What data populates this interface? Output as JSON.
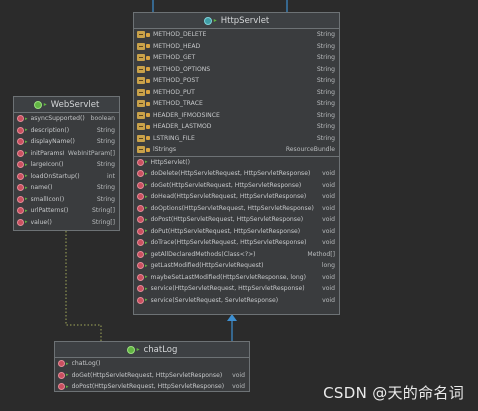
{
  "diagram": {
    "http_servlet": {
      "title": "HttpServlet",
      "fields": [
        {
          "name": "METHOD_DELETE",
          "type": "String"
        },
        {
          "name": "METHOD_HEAD",
          "type": "String"
        },
        {
          "name": "METHOD_GET",
          "type": "String"
        },
        {
          "name": "METHOD_OPTIONS",
          "type": "String"
        },
        {
          "name": "METHOD_POST",
          "type": "String"
        },
        {
          "name": "METHOD_PUT",
          "type": "String"
        },
        {
          "name": "METHOD_TRACE",
          "type": "String"
        },
        {
          "name": "HEADER_IFMODSINCE",
          "type": "String"
        },
        {
          "name": "HEADER_LASTMOD",
          "type": "String"
        },
        {
          "name": "LSTRING_FILE",
          "type": "String"
        },
        {
          "name": "lStrings",
          "type": "ResourceBundle"
        }
      ],
      "methods": [
        {
          "name": "HttpServlet()",
          "type": ""
        },
        {
          "name": "doDelete(HttpServletRequest, HttpServletResponse)",
          "type": "void"
        },
        {
          "name": "doGet(HttpServletRequest, HttpServletResponse)",
          "type": "void"
        },
        {
          "name": "doHead(HttpServletRequest, HttpServletResponse)",
          "type": "void"
        },
        {
          "name": "doOptions(HttpServletRequest, HttpServletResponse)",
          "type": "void"
        },
        {
          "name": "doPost(HttpServletRequest, HttpServletResponse)",
          "type": "void"
        },
        {
          "name": "doPut(HttpServletRequest, HttpServletResponse)",
          "type": "void"
        },
        {
          "name": "doTrace(HttpServletRequest, HttpServletResponse)",
          "type": "void"
        },
        {
          "name": "getAllDeclaredMethods(Class<?>)",
          "type": "Method[]"
        },
        {
          "name": "getLastModified(HttpServletRequest)",
          "type": "long"
        },
        {
          "name": "maybeSetLastModified(HttpServletResponse, long)",
          "type": "void"
        },
        {
          "name": "service(HttpServletRequest, HttpServletResponse)",
          "type": "void"
        },
        {
          "name": "service(ServletRequest, ServletResponse)",
          "type": "void"
        }
      ]
    },
    "web_servlet": {
      "title": "WebServlet",
      "methods": [
        {
          "name": "asyncSupported()",
          "type": "boolean"
        },
        {
          "name": "description()",
          "type": "String"
        },
        {
          "name": "displayName()",
          "type": "String"
        },
        {
          "name": "initParams()",
          "type": "WebInitParam[]"
        },
        {
          "name": "largeIcon()",
          "type": "String"
        },
        {
          "name": "loadOnStartup()",
          "type": "int"
        },
        {
          "name": "name()",
          "type": "String"
        },
        {
          "name": "smallIcon()",
          "type": "String"
        },
        {
          "name": "urlPatterns()",
          "type": "String[]"
        },
        {
          "name": "value()",
          "type": "String[]"
        }
      ]
    },
    "chat_log": {
      "title": "chatLog",
      "methods": [
        {
          "name": "chatLog()",
          "type": ""
        },
        {
          "name": "doGet(HttpServletRequest, HttpServletResponse)",
          "type": "void"
        },
        {
          "name": "doPost(HttpServletRequest, HttpServletResponse)",
          "type": "void"
        }
      ]
    }
  },
  "watermark": "CSDN @天的命名词",
  "colors": {
    "background": "#2b2b2b",
    "box_fill": "#3a3c3e",
    "box_border": "#6d7275",
    "inherit_line": "#3d8fd1",
    "annotation_line": "#a0a85a"
  },
  "icons": {
    "class": "class-icon",
    "field": "field-icon",
    "method": "method-icon"
  }
}
